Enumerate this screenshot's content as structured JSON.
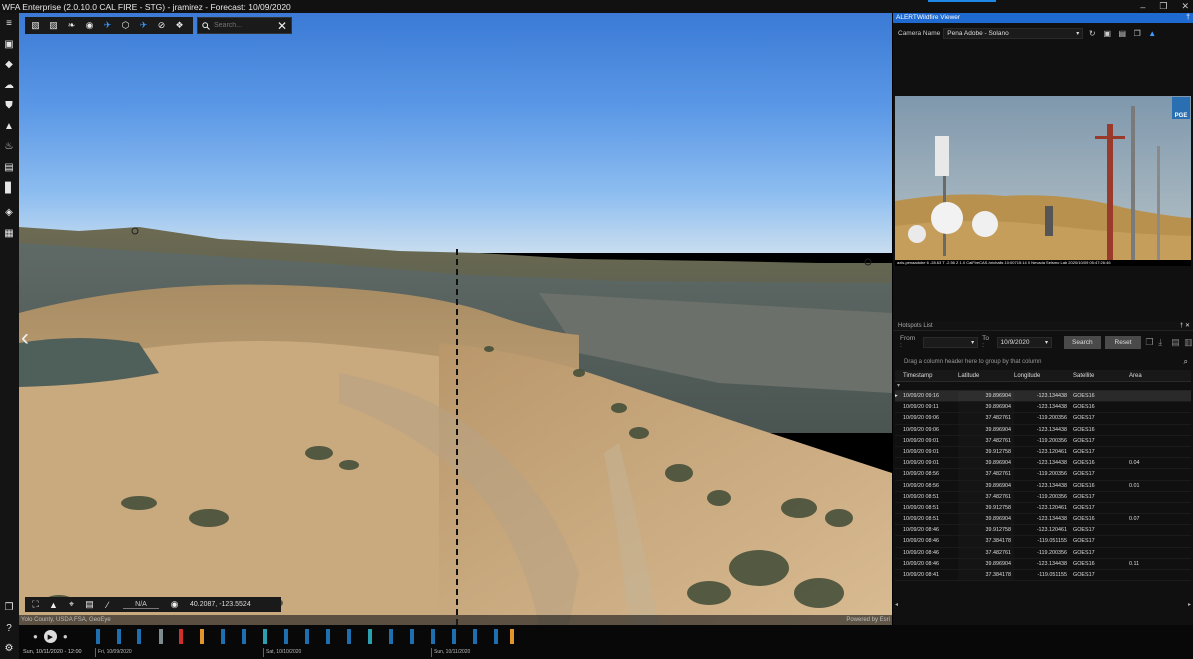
{
  "window": {
    "title": "WFA Enterprise (2.0.10.0 CAL FIRE - STG) - jramirez - Forecast: 10/09/2020",
    "minimize_glyph": "–",
    "restore_glyph": "❒",
    "close_glyph": "✕"
  },
  "rail": {
    "icons": [
      {
        "name": "menu-icon",
        "glyph": "≡"
      },
      {
        "name": "calendar-icon",
        "glyph": "▣"
      },
      {
        "name": "route-icon",
        "glyph": "◆"
      },
      {
        "name": "weather-icon",
        "glyph": "☁"
      },
      {
        "name": "shield-icon",
        "glyph": "⛊"
      },
      {
        "name": "warning-icon",
        "glyph": "▲"
      },
      {
        "name": "fire-icon",
        "glyph": "♨"
      },
      {
        "name": "truck-icon",
        "glyph": "▤"
      },
      {
        "name": "chart-icon",
        "glyph": "▊"
      },
      {
        "name": "layers-icon",
        "glyph": "◈"
      },
      {
        "name": "apps-icon",
        "glyph": "▦"
      }
    ],
    "bottom_icons": [
      {
        "name": "window-icon",
        "glyph": "❐"
      },
      {
        "name": "help-icon",
        "glyph": "?"
      },
      {
        "name": "settings-icon",
        "glyph": "⚙"
      }
    ]
  },
  "map_toolbar": {
    "tools": [
      {
        "name": "map-tool-icon",
        "glyph": "▧",
        "active": false
      },
      {
        "name": "wx-tool-icon",
        "glyph": "▨",
        "active": false
      },
      {
        "name": "leaf-tool-icon",
        "glyph": "❧",
        "active": false
      },
      {
        "name": "camera-tool-icon",
        "glyph": "◉",
        "active": false
      },
      {
        "name": "satellite-tool-icon",
        "glyph": "✈",
        "active": true
      },
      {
        "name": "hazard-tool-icon",
        "glyph": "⬡",
        "active": false
      },
      {
        "name": "aircraft-tool-icon",
        "glyph": "✈",
        "active": true
      },
      {
        "name": "no-fly-tool-icon",
        "glyph": "⊘",
        "active": false
      },
      {
        "name": "puzzle-tool-icon",
        "glyph": "❖",
        "active": false
      }
    ],
    "search_placeholder": "Search...",
    "clear_glyph": "✕"
  },
  "map_bottom": {
    "na_text": "N/A",
    "coordinates": "40.2087, -123.5524"
  },
  "attribution": {
    "left": "Yolo County, USDA FSA, GeoEye",
    "right": "Powered by Esri"
  },
  "camera_viewer": {
    "header": "ALERTWildfire Viewer",
    "camera_label": "Camera Name",
    "camera_value": "Pena Adobe - Solano",
    "logo_text": "PGE",
    "caption": "axis-penaadobe 6 -28.63 T -2.56 Z 1.0 CalFireCAS-hrichalls 10:00715:14 0 Nevada Seismo Lab 2020/10/09 05:47:26:46"
  },
  "hotspots": {
    "header": "Hotspots List",
    "from_label": "From :",
    "from_value": "",
    "to_label": "To :",
    "to_value": "10/9/2020",
    "search_label": "Search",
    "reset_label": "Reset",
    "group_hint": "Drag a column header here to group by that column",
    "columns": [
      "Timestamp",
      "Latitude",
      "Longitude",
      "Satellite",
      "Area"
    ],
    "rows": [
      [
        "10/09/20 09:16",
        "39.896904",
        "-123.134438",
        "GOES16",
        ""
      ],
      [
        "10/09/20 09:11",
        "39.896904",
        "-123.134438",
        "GOES16",
        ""
      ],
      [
        "10/09/20 09:06",
        "37.482761",
        "-119.200356",
        "GOES17",
        ""
      ],
      [
        "10/09/20 09:06",
        "39.896904",
        "-123.134438",
        "GOES16",
        ""
      ],
      [
        "10/09/20 09:01",
        "37.482761",
        "-119.200356",
        "GOES17",
        ""
      ],
      [
        "10/09/20 09:01",
        "39.912758",
        "-123.120461",
        "GOES17",
        ""
      ],
      [
        "10/09/20 09:01",
        "39.896904",
        "-123.134438",
        "GOES16",
        "0.04"
      ],
      [
        "10/09/20 08:56",
        "37.482761",
        "-119.200356",
        "GOES17",
        ""
      ],
      [
        "10/09/20 08:56",
        "39.896904",
        "-123.134438",
        "GOES16",
        "0.01"
      ],
      [
        "10/09/20 08:51",
        "37.482761",
        "-119.200356",
        "GOES17",
        ""
      ],
      [
        "10/09/20 08:51",
        "39.912758",
        "-123.120461",
        "GOES17",
        ""
      ],
      [
        "10/09/20 08:51",
        "39.896904",
        "-123.134438",
        "GOES16",
        "0.07"
      ],
      [
        "10/09/20 08:46",
        "39.912758",
        "-123.120461",
        "GOES17",
        ""
      ],
      [
        "10/09/20 08:46",
        "37.384178",
        "-119.051155",
        "GOES17",
        ""
      ],
      [
        "10/09/20 08:46",
        "37.482761",
        "-119.200356",
        "GOES17",
        ""
      ],
      [
        "10/09/20 08:46",
        "39.896904",
        "-123.134438",
        "GOES16",
        "0.11"
      ],
      [
        "10/09/20 08:41",
        "37.384178",
        "-119.051155",
        "GOES17",
        ""
      ]
    ]
  },
  "timeline": {
    "current": "Sun, 10/11/2020 - 12:00",
    "ticks": [
      "Fri, 10/09/2020",
      "Sat, 10/10/2020",
      "Sun, 10/11/2020"
    ],
    "bar_colors": {
      "blue": "#1e6fb0",
      "red": "#d0302a",
      "orange": "#e2962a",
      "gray": "#7f8c8d",
      "teal": "#2aa0b0"
    }
  }
}
